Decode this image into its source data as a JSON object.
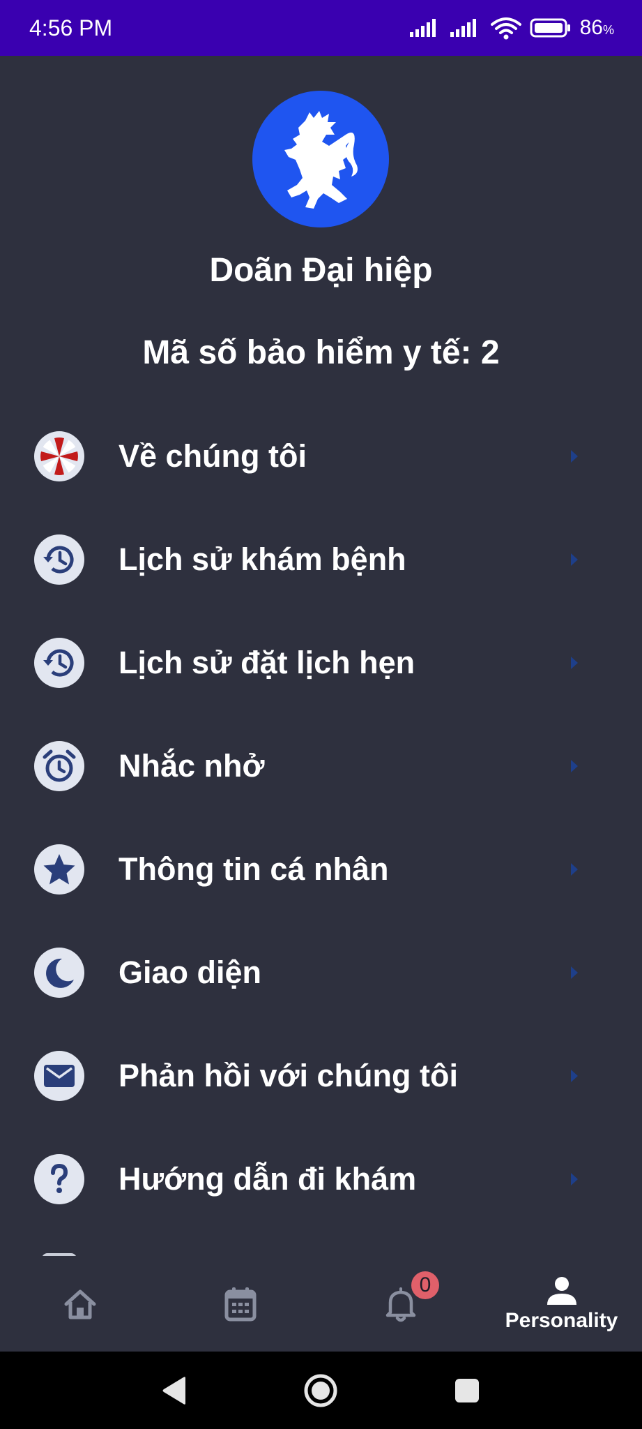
{
  "status_bar": {
    "time": "4:56 PM",
    "battery_percent": "86",
    "battery_unit": "%"
  },
  "profile": {
    "avatar_icon": "rampant-lion-icon",
    "name": "Doãn Đại hiệp",
    "insurance_text": "Mã số bảo hiểm y tế: 2"
  },
  "menu": {
    "items": [
      {
        "label": "Về chúng tôi",
        "icon": "umbrella-logo-icon"
      },
      {
        "label": "Lịch sử khám bệnh",
        "icon": "history-icon"
      },
      {
        "label": "Lịch sử đặt lịch hẹn",
        "icon": "history-icon"
      },
      {
        "label": "Nhắc nhở",
        "icon": "alarm-clock-icon"
      },
      {
        "label": "Thông tin cá nhân",
        "icon": "star-icon"
      },
      {
        "label": "Giao diện",
        "icon": "moon-icon"
      },
      {
        "label": "Phản hồi với chúng tôi",
        "icon": "mail-icon"
      },
      {
        "label": "Hướng dẫn đi khám",
        "icon": "question-icon"
      }
    ]
  },
  "tab_bar": {
    "tabs": [
      {
        "name": "home",
        "icon": "home-icon"
      },
      {
        "name": "calendar",
        "icon": "calendar-icon"
      },
      {
        "name": "notifications",
        "icon": "bell-icon",
        "badge": "0"
      },
      {
        "name": "personality",
        "icon": "person-icon",
        "label": "Personality",
        "active": true
      }
    ]
  },
  "colors": {
    "status_bar": "#3a00b0",
    "background": "#2e303e",
    "avatar": "#1f55f0",
    "icon_bg": "#e2e6f0",
    "icon_fg": "#2a3e7a",
    "chevron": "#1e3f8a",
    "badge": "#e0606a"
  }
}
